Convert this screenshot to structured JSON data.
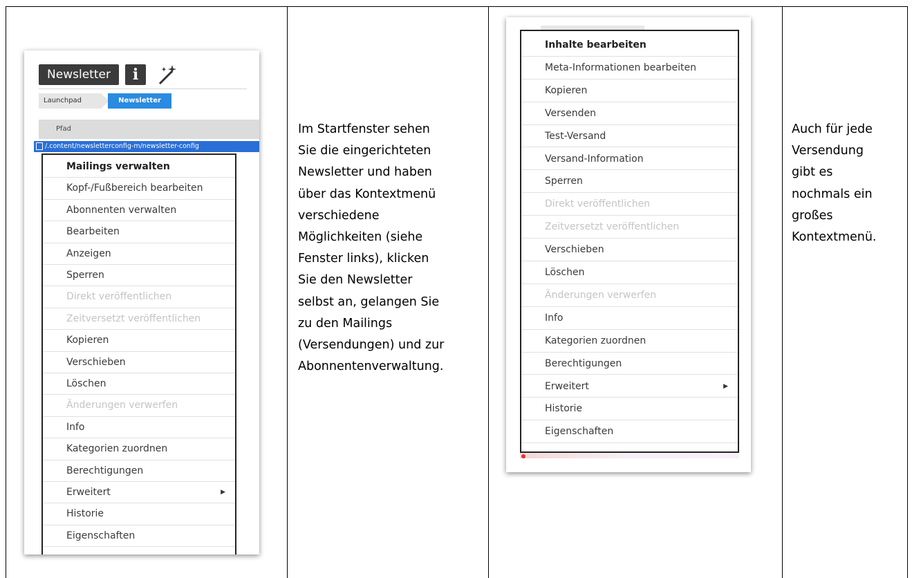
{
  "left_panel": {
    "title": "Newsletter",
    "info_icon": "info-icon",
    "wand_icon": "magic-wand-icon",
    "breadcrumb": [
      "Launchpad",
      "Newsletter"
    ],
    "column_header": "Pfad",
    "path_value": "/.content/newsletterconfig-m/newsletter-config",
    "menu_items": [
      {
        "label": "Mailings verwalten",
        "bold": true
      },
      {
        "label": "Kopf-/Fußbereich bearbeiten"
      },
      {
        "label": "Abonnenten verwalten"
      },
      {
        "label": "Bearbeiten"
      },
      {
        "label": "Anzeigen"
      },
      {
        "label": "Sperren"
      },
      {
        "label": "Direkt veröffentlichen",
        "disabled": true
      },
      {
        "label": "Zeitversetzt veröffentlichen",
        "disabled": true
      },
      {
        "label": "Kopieren"
      },
      {
        "label": "Verschieben"
      },
      {
        "label": "Löschen"
      },
      {
        "label": "Änderungen verwerfen",
        "disabled": true
      },
      {
        "label": "Info"
      },
      {
        "label": "Kategorien zuordnen"
      },
      {
        "label": "Berechtigungen"
      },
      {
        "label": "Erweitert",
        "submenu": true
      },
      {
        "label": "Historie"
      },
      {
        "label": "Eigenschaften"
      }
    ]
  },
  "middle_text": [
    "Im Startfenster sehen",
    "Sie die eingerichteten",
    "Newsletter und haben",
    "über das Kontextmenü",
    "verschiedene",
    "Möglichkeiten (siehe",
    "Fenster links), klicken",
    "Sie den Newsletter",
    "selbst an, gelangen Sie",
    "zu den Mailings",
    "(Versendungen) und zur",
    "Abonnentenverwaltung."
  ],
  "right_panel": {
    "menu_items": [
      {
        "label": "Inhalte bearbeiten",
        "bold": true
      },
      {
        "label": "Meta-Informationen bearbeiten"
      },
      {
        "label": "Kopieren"
      },
      {
        "label": "Versenden"
      },
      {
        "label": "Test-Versand"
      },
      {
        "label": "Versand-Information"
      },
      {
        "label": "Sperren"
      },
      {
        "label": "Direkt veröffentlichen",
        "disabled": true
      },
      {
        "label": "Zeitversetzt veröffentlichen",
        "disabled": true
      },
      {
        "label": "Verschieben"
      },
      {
        "label": "Löschen"
      },
      {
        "label": "Änderungen verwerfen",
        "disabled": true
      },
      {
        "label": "Info"
      },
      {
        "label": "Kategorien zuordnen"
      },
      {
        "label": "Berechtigungen"
      },
      {
        "label": "Erweitert",
        "submenu": true
      },
      {
        "label": "Historie"
      },
      {
        "label": "Eigenschaften"
      }
    ]
  },
  "far_right_text": [
    "Auch für jede",
    "Versendung",
    "gibt es",
    "nochmals ein",
    "großes",
    "Kontextmenü."
  ]
}
